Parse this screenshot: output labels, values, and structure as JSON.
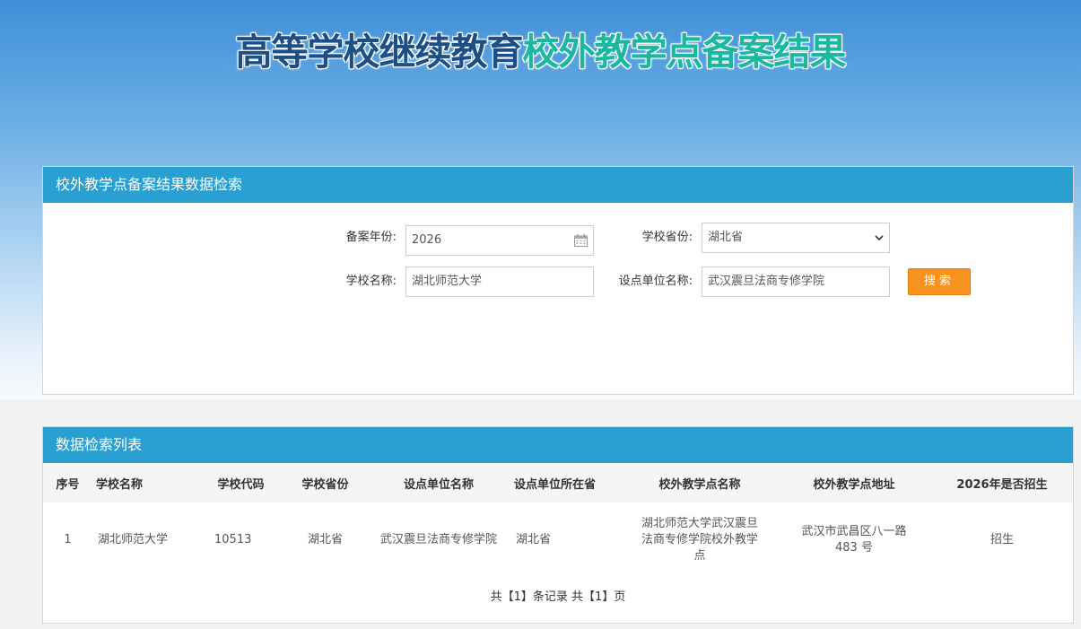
{
  "page": {
    "title_part1": "高等学校继续教育",
    "title_part2": "校外教学点备案结果"
  },
  "search_panel": {
    "header": "校外教学点备案结果数据检索",
    "year_label": "备案年份:",
    "year_value": "2026",
    "province_label": "学校省份:",
    "province_value": "湖北省",
    "school_label": "学校名称:",
    "school_value": "湖北师范大学",
    "unit_label": "设点单位名称:",
    "unit_value": "武汉震旦法商专修学院",
    "search_button": "搜索"
  },
  "list_panel": {
    "header": "数据检索列表",
    "columns": [
      "序号",
      "学校名称",
      "学校代码",
      "学校省份",
      "设点单位名称",
      "设点单位所在省",
      "校外教学点名称",
      "校外教学点地址",
      "2026年是否招生"
    ],
    "rows": [
      {
        "index": "1",
        "school": "湖北师范大学",
        "code": "10513",
        "province": "湖北省",
        "unit": "武汉震旦法商专修学院",
        "unit_province": "湖北省",
        "site_name": "湖北师范大学武汉震旦法商专修学院校外教学点",
        "site_address": "武汉市武昌区八一路483 号",
        "enroll": "招生"
      }
    ],
    "pager": "共【1】条记录 共【1】页"
  },
  "colors": {
    "header_blue": "#2a9fd1",
    "button_orange": "#f7931e",
    "title_dark": "#1d4f86",
    "title_teal": "#19b89f"
  },
  "icons": {
    "calendar": "calendar-icon",
    "dropdown": "chevron-down-icon"
  }
}
